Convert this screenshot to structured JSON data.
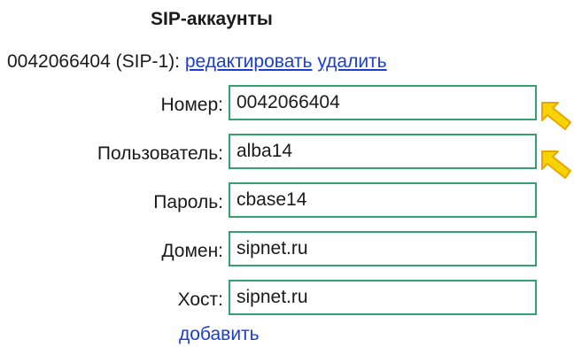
{
  "section": {
    "title": "SIP-аккаунты"
  },
  "account": {
    "id_label": "0042066404 (SIP-1):",
    "edit_link": "редактировать",
    "delete_link": "удалить"
  },
  "form": {
    "number_label": "Номер:",
    "number_value": "0042066404",
    "user_label": "Пользователь:",
    "user_value": "alba14",
    "password_label": "Пароль:",
    "password_value": "cbase14",
    "domain_label": "Домен:",
    "domain_value": "sipnet.ru",
    "host_label": "Хост:",
    "host_value": "sipnet.ru"
  },
  "actions": {
    "add_link": "добавить"
  },
  "colors": {
    "link": "#1a3fd0",
    "input_border": "#35a06e",
    "arrow_fill": "#f6d400",
    "arrow_outline": "#e9a500"
  },
  "icons": {
    "highlight_arrow": "arrow-pointing-up-left-icon"
  }
}
